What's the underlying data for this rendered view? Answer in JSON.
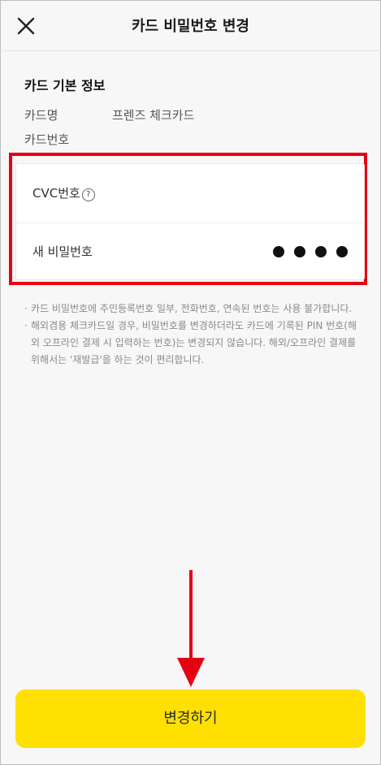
{
  "header": {
    "title": "카드 비밀번호 변경",
    "close_icon": "close-icon"
  },
  "card_info": {
    "section_title": "카드 기본 정보",
    "name_label": "카드명",
    "name_value": "프렌즈 체크카드",
    "number_label": "카드번호",
    "number_value": ""
  },
  "form": {
    "cvc_label": "CVC번호",
    "cvc_help": "?",
    "new_pin_label": "새 비밀번호",
    "new_pin_length": 4
  },
  "notes": [
    "카드 비밀번호에 주민등록번호 일부, 전화번호, 연속된 번호는 사용 불가합니다.",
    "해외겸용 체크카드일 경우, 비밀번호를 변경하더라도 카드에 기록된 PIN 번호(해외 오프라인 결제 시 입력하는 번호)는 변경되지 않습니다. 해외/오프라인 결제를 위해서는 '재발급'을 하는 것이 편리합니다."
  ],
  "submit_label": "변경하기",
  "colors": {
    "accent": "#ffe000",
    "highlight": "#e60012",
    "arrow": "#e60012"
  }
}
